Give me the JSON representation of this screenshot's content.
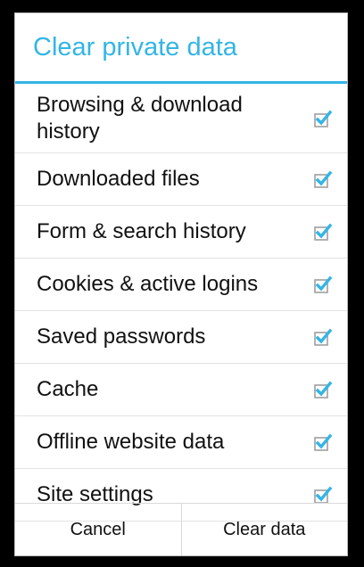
{
  "dialog": {
    "title": "Clear private data",
    "accent_color": "#33b5e5",
    "items": [
      {
        "label": "Browsing & download history",
        "checked": true,
        "icon": "checkbox-checked-icon"
      },
      {
        "label": "Downloaded files",
        "checked": true,
        "icon": "checkbox-checked-icon"
      },
      {
        "label": "Form & search history",
        "checked": true,
        "icon": "checkbox-checked-icon"
      },
      {
        "label": "Cookies & active logins",
        "checked": true,
        "icon": "checkbox-checked-icon"
      },
      {
        "label": "Saved passwords",
        "checked": true,
        "icon": "checkbox-checked-icon"
      },
      {
        "label": "Cache",
        "checked": true,
        "icon": "checkbox-checked-icon"
      },
      {
        "label": "Offline website data",
        "checked": true,
        "icon": "checkbox-checked-icon"
      },
      {
        "label": "Site settings",
        "checked": true,
        "icon": "checkbox-checked-icon"
      }
    ],
    "buttons": {
      "cancel_label": "Cancel",
      "clear_label": "Clear data"
    }
  }
}
